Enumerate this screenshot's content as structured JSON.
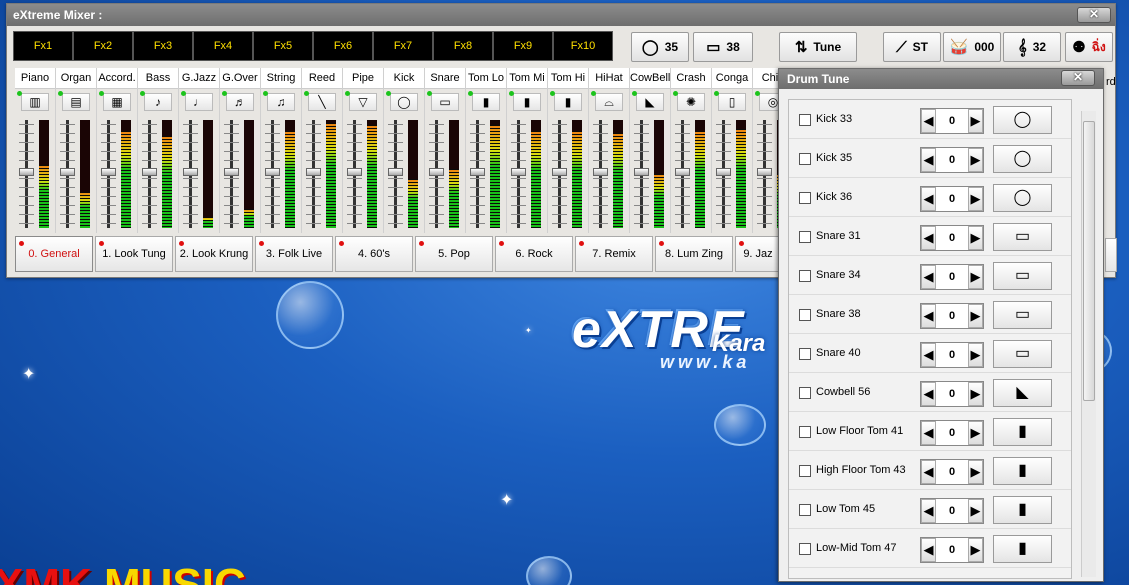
{
  "mixer": {
    "title": "eXtreme Mixer :",
    "close_label": "✕",
    "fx": [
      "Fx1",
      "Fx2",
      "Fx3",
      "Fx4",
      "Fx5",
      "Fx6",
      "Fx7",
      "Fx8",
      "Fx9",
      "Fx10"
    ],
    "tools": [
      {
        "icon": "kick-drum-icon",
        "glyph": "◯",
        "value": "35"
      },
      {
        "icon": "snare-drum-icon",
        "glyph": "▭",
        "value": "38"
      },
      {
        "icon": "tune-arrows-icon",
        "glyph": "⇅",
        "value": "Tune"
      },
      {
        "icon": "drumsticks-icon",
        "glyph": "⟋",
        "value": "ST"
      },
      {
        "icon": "drum-kit-icon",
        "glyph": "🥁",
        "value": "000"
      },
      {
        "icon": "guitar-icon",
        "glyph": "𝄞",
        "value": "32"
      },
      {
        "icon": "maracas-icon",
        "glyph": "⚉",
        "value": "ฉิ่ง"
      }
    ],
    "channels": [
      {
        "name": "Piano",
        "icon": "piano-icon",
        "glyph": "▥",
        "level": 0.58,
        "fader": 0.48
      },
      {
        "name": "Organ",
        "icon": "organ-icon",
        "glyph": "▤",
        "level": 0.33,
        "fader": 0.48
      },
      {
        "name": "Accord.",
        "icon": "accordion-icon",
        "glyph": "▦",
        "level": 0.9,
        "fader": 0.48
      },
      {
        "name": "Bass",
        "icon": "bass-guitar-icon",
        "glyph": "♪",
        "level": 0.85,
        "fader": 0.48
      },
      {
        "name": "G.Jazz",
        "icon": "jazz-guitar-icon",
        "glyph": "♩",
        "level": 0.1,
        "fader": 0.48
      },
      {
        "name": "G.Over",
        "icon": "overdrive-guitar-icon",
        "glyph": "♬",
        "level": 0.18,
        "fader": 0.48
      },
      {
        "name": "String",
        "icon": "violin-icon",
        "glyph": "♫",
        "level": 0.9,
        "fader": 0.48
      },
      {
        "name": "Reed",
        "icon": "reed-icon",
        "glyph": "╲",
        "level": 0.97,
        "fader": 0.48
      },
      {
        "name": "Pipe",
        "icon": "pipe-flute-icon",
        "glyph": "▽",
        "level": 0.95,
        "fader": 0.48
      },
      {
        "name": "Kick",
        "icon": "kick-icon",
        "glyph": "◯",
        "level": 0.45,
        "fader": 0.48
      },
      {
        "name": "Snare",
        "icon": "snare-icon",
        "glyph": "▭",
        "level": 0.55,
        "fader": 0.48
      },
      {
        "name": "Tom Lo",
        "icon": "tom-lo-icon",
        "glyph": "▮",
        "level": 0.95,
        "fader": 0.48
      },
      {
        "name": "Tom Mi",
        "icon": "tom-mi-icon",
        "glyph": "▮",
        "level": 0.9,
        "fader": 0.48
      },
      {
        "name": "Tom Hi",
        "icon": "tom-hi-icon",
        "glyph": "▮",
        "level": 0.9,
        "fader": 0.48
      },
      {
        "name": "HiHat",
        "icon": "hihat-icon",
        "glyph": "⌓",
        "level": 0.88,
        "fader": 0.48
      },
      {
        "name": "CowBell",
        "icon": "cowbell-icon",
        "glyph": "◣",
        "level": 0.5,
        "fader": 0.48
      },
      {
        "name": "Crash",
        "icon": "crash-cymbal-icon",
        "glyph": "✺",
        "level": 0.9,
        "fader": 0.48
      },
      {
        "name": "Conga",
        "icon": "conga-icon",
        "glyph": "▯",
        "level": 0.92,
        "fader": 0.48
      },
      {
        "name": "Chin",
        "icon": "ching-icon",
        "glyph": "◎",
        "level": 0.5,
        "fader": 0.48
      }
    ],
    "presets": [
      "0. General",
      "1. Look Tung",
      "2. Look Krung",
      "3. Folk Live",
      "4. 60's",
      "5. Pop",
      "6. Rock",
      "7. Remix",
      "8. Lum Zing",
      "9. Jaz"
    ],
    "active_preset": 0,
    "trailing_channel_text": "rd"
  },
  "tune": {
    "title": "Drum Tune",
    "close_label": "✕",
    "items": [
      {
        "label": "Kick 33",
        "value": "0",
        "icon": "kick-drum-icon",
        "glyph": "◯",
        "checked": false
      },
      {
        "label": "Kick 35",
        "value": "0",
        "icon": "kick-drum-icon",
        "glyph": "◯",
        "checked": false
      },
      {
        "label": "Kick 36",
        "value": "0",
        "icon": "kick-drum-icon",
        "glyph": "◯",
        "checked": false
      },
      {
        "label": "Snare 31",
        "value": "0",
        "icon": "snare-drum-icon",
        "glyph": "▭",
        "checked": false
      },
      {
        "label": "Snare 34",
        "value": "0",
        "icon": "snare-drum-icon",
        "glyph": "▭",
        "checked": false
      },
      {
        "label": "Snare 38",
        "value": "0",
        "icon": "snare-drum-icon",
        "glyph": "▭",
        "checked": false
      },
      {
        "label": "Snare 40",
        "value": "0",
        "icon": "snare-drum-icon",
        "glyph": "▭",
        "checked": false
      },
      {
        "label": "Cowbell 56",
        "value": "0",
        "icon": "cowbell-icon",
        "glyph": "◣",
        "checked": false
      },
      {
        "label": "Low Floor Tom 41",
        "value": "0",
        "icon": "tom-drum-icon",
        "glyph": "▮",
        "checked": false
      },
      {
        "label": "High Floor Tom 43",
        "value": "0",
        "icon": "tom-drum-icon",
        "glyph": "▮",
        "checked": false
      },
      {
        "label": "Low Tom 45",
        "value": "0",
        "icon": "tom-drum-icon",
        "glyph": "▮",
        "checked": false
      },
      {
        "label": "Low-Mid Tom 47",
        "value": "0",
        "icon": "tom-drum-icon",
        "glyph": "▮",
        "checked": false
      }
    ]
  },
  "desktop": {
    "logo_main": "eXTRE",
    "logo_sub": "Kara",
    "logo_url": "www.ka",
    "brand_a": "XMK ",
    "brand_b": "MUSIC"
  }
}
